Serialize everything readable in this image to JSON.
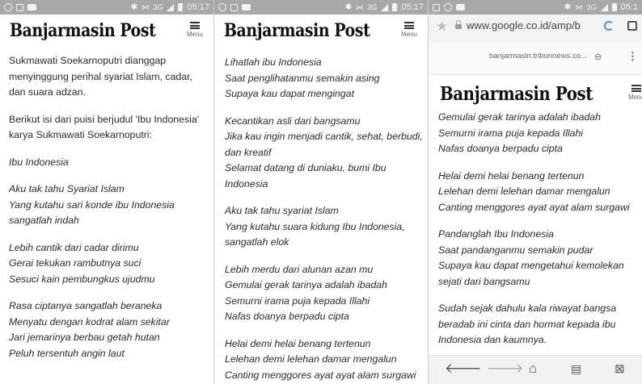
{
  "status_bar": {
    "panel1_time": "05:17",
    "panel2_time": "05:17",
    "panel3_time": "05:1",
    "network": "3G"
  },
  "brand": "Banjarmasin Post",
  "menu_label": "Menu",
  "panel1": {
    "paragraphs": [
      {
        "italic": false,
        "lines": [
          "Sukmawati Soekarnoputri dianggap",
          "menyinggung perihal syariat Islam, cadar,",
          "dan suara adzan."
        ]
      },
      {
        "italic": false,
        "lines": [
          "Berikut isi dari puisi berjudul 'Ibu Indonesia'",
          "karya Sukmawati Soekarnoputri:"
        ]
      },
      {
        "italic": true,
        "lines": [
          "Ibu Indonesia"
        ]
      },
      {
        "italic": true,
        "lines": [
          "Aku tak tahu Syariat Islam",
          "Yang kutahu sari konde ibu Indonesia",
          "sangatlah indah"
        ]
      },
      {
        "italic": true,
        "lines": [
          "Lebih cantik dari cadar dirimu",
          "Gerai tekukan rambutnya suci",
          "Sesuci kain pembungkus ujudmu"
        ]
      },
      {
        "italic": true,
        "lines": [
          "Rasa ciptanya sangatlah beraneka",
          "Menyatu dengan kodrat alam sekitar",
          "Jari jemarinya berbau getah hutan",
          "Peluh tersentuh angin laut"
        ]
      }
    ]
  },
  "panel2": {
    "paragraphs": [
      {
        "italic": true,
        "lines": [
          "Lihatlah ibu Indonesia",
          "Saat penglihatanmu semakin asing",
          "Supaya kau dapat mengingat"
        ]
      },
      {
        "italic": true,
        "lines": [
          "Kecantikan asli dari bangsamu",
          "Jika kau ingin menjadi cantik, sehat, berbudi,",
          "dan kreatif",
          "Selamat datang di duniaku, bumi Ibu",
          "Indonesia"
        ]
      },
      {
        "italic": true,
        "lines": [
          "Aku tak tahu syariat Islam",
          "Yang kutahu suara kidung Ibu Indonesia,",
          "sangatlah elok"
        ]
      },
      {
        "italic": true,
        "lines": [
          "Lebih merdu dari alunan azan mu",
          "Gemulai gerak tarinya adalah ibadah",
          "Semurni irama puja kepada Illahi",
          "Nafas doanya berpadu cipta"
        ]
      },
      {
        "italic": true,
        "lines": [
          "Helai demi helai benang tertenun",
          "Lelehan demi lelehan damar mengalun",
          "Canting menggores ayat ayat alam surgawi"
        ]
      }
    ]
  },
  "panel3": {
    "browser_url": "www.google.co.id/amp/b",
    "amp_url": "banjarmasin.tribunnews.co...",
    "paragraphs": [
      {
        "italic": true,
        "lines": [
          "Gemulai gerak tarinya adalah ibadah",
          "Semurni irama puja kepada Illahi",
          "Nafas doanya berpadu cipta"
        ]
      },
      {
        "italic": true,
        "lines": [
          "Helai demi helai benang tertenun",
          "Lelehan demi lelehan damar mengalun",
          "Canting menggores ayat ayat alam surgawi"
        ]
      },
      {
        "italic": true,
        "lines": [
          "Pandanglah Ibu Indonesia",
          "Saat pandanganmu semakin pudar",
          "Supaya kau dapat mengetahui kemolekan",
          "sejati dari bangsamu"
        ]
      },
      {
        "italic": true,
        "lines": [
          "Sudah sejak dahulu kala riwayat bangsa",
          "beradab ini cinta dan hormat kepada ibu",
          "Indonesia dan kaumnya."
        ]
      }
    ]
  },
  "icons": {
    "status": [
      "whatsapp-icon",
      "image-icon",
      "message-icon",
      "bluetooth-icon",
      "mute-icon",
      "signal-icon",
      "battery-icon"
    ],
    "browser": [
      "star-icon",
      "lock-icon",
      "reload-icon",
      "tabs-icon",
      "link-icon",
      "more-icon"
    ],
    "bottom_nav": [
      "back-icon",
      "forward-icon",
      "home-icon",
      "reader-icon",
      "bookmark-icon"
    ]
  }
}
